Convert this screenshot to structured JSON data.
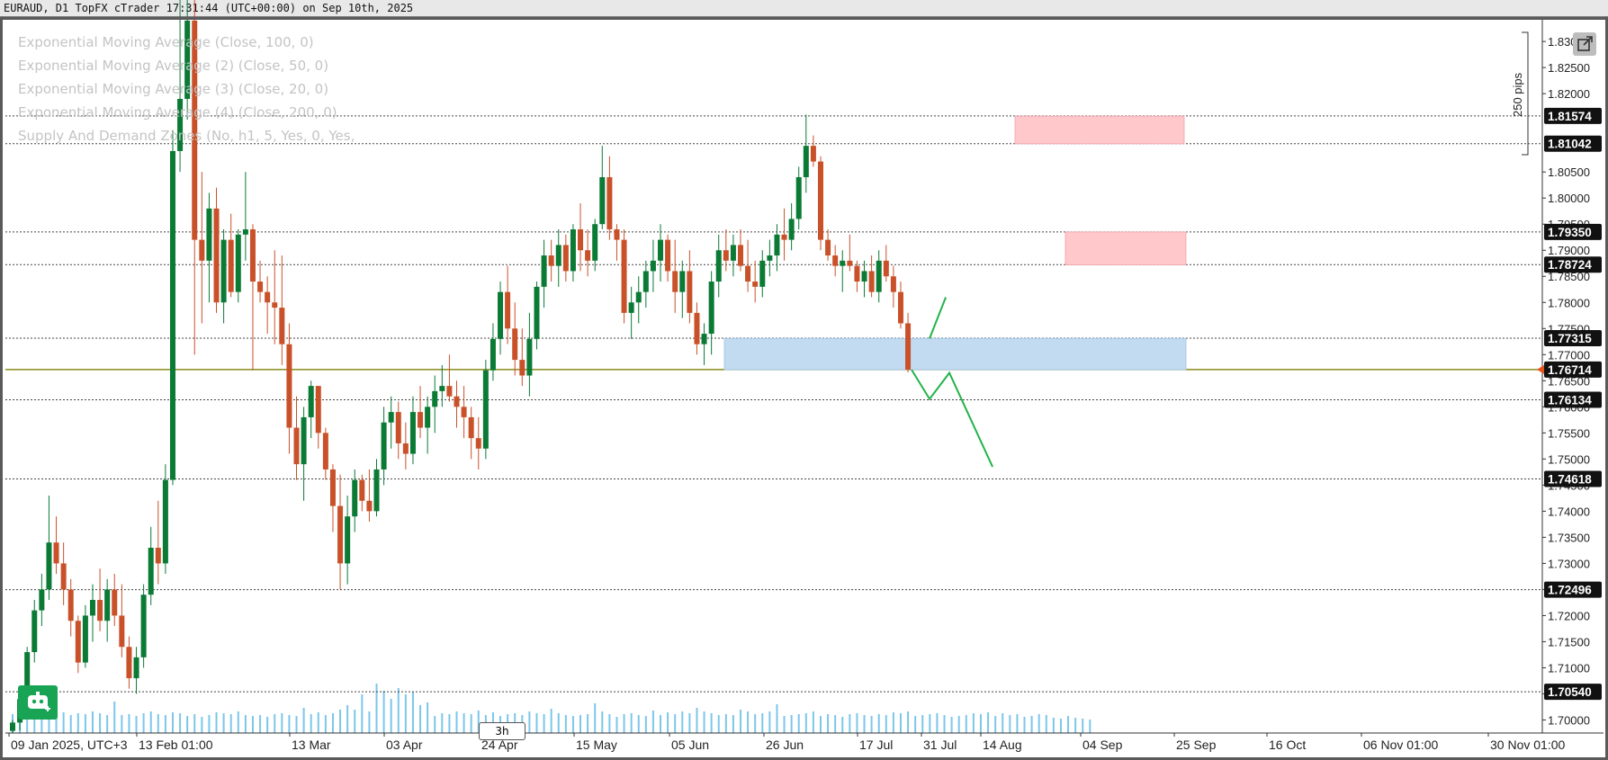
{
  "header": {
    "title": "EURAUD, D1 TopFX cTrader 17:31:44 (UTC+00:00) on Sep 10th, 2025"
  },
  "indicators": [
    "Exponential Moving Average (Close, 100, 0)",
    "Exponential Moving Average (2) (Close, 50, 0)",
    "Exponential Moving Average (3) (Close, 20, 0)",
    "Exponential Moving Average (4) (Close, 200, 0)",
    "Supply And Demand Zones (No, h1, 5, Yes, 0, Yes,"
  ],
  "timeframe_label": "3h",
  "ruler_label": "250 pips",
  "icons": [
    "bot-icon",
    "popout-icon"
  ],
  "colors": {
    "bull": "#0a7a35",
    "bear": "#c9512a",
    "volume": "#7cc6ea",
    "supply_zone": "#ffc9cc",
    "demand_zone": "#c2dbf0",
    "current_price_line": "#8a8a1a",
    "projection": "#22b34a"
  },
  "chart_data": {
    "type": "candlestick",
    "symbol": "EURAUD",
    "timeframe": "D1",
    "x_ticks": [
      "09 Jan 2025, UTC+3",
      "13 Feb 01:00",
      "13 Mar",
      "03 Apr",
      "24 Apr",
      "15 May",
      "05 Jun",
      "26 Jun",
      "17 Jul",
      "31 Jul",
      "14 Aug",
      "04 Sep",
      "25 Sep",
      "16 Oct",
      "06 Nov 01:00",
      "30 Nov 01:00"
    ],
    "y_ticks": [
      "1.8300",
      "1.8250",
      "1.8200",
      "1.8050",
      "1.8000",
      "1.7950",
      "1.7900",
      "1.7850",
      "1.7800",
      "1.7750",
      "1.7700",
      "1.7650",
      "1.7600",
      "1.7550",
      "1.7500",
      "1.7450",
      "1.7400",
      "1.7350",
      "1.7300",
      "1.7250",
      "1.7200",
      "1.7150",
      "1.7100",
      "1.7050",
      "1.7000"
    ],
    "ylim": [
      1.6975,
      1.8345
    ],
    "price_levels": [
      "1.81574",
      "1.81042",
      "1.79350",
      "1.78724",
      "1.77315",
      "1.76714",
      "1.76134",
      "1.74618",
      "1.72496",
      "1.70540"
    ],
    "current_price": "1.76714",
    "zones": [
      {
        "type": "supply",
        "from": 1.8104,
        "to": 1.8157
      },
      {
        "type": "supply",
        "from": 1.7872,
        "to": 1.7935
      },
      {
        "type": "demand",
        "from": 1.7671,
        "to": 1.7731
      }
    ],
    "projection_path": [
      1.7731,
      1.781
    ],
    "projection_path_down": [
      1.7671,
      1.7615,
      1.7665,
      1.7485
    ],
    "candles": [
      [
        1.6979,
        1.7,
        1.6975,
        1.6995
      ],
      [
        1.6995,
        1.705,
        1.698,
        1.704
      ],
      [
        1.704,
        1.714,
        1.702,
        1.713
      ],
      [
        1.713,
        1.723,
        1.711,
        1.721
      ],
      [
        1.721,
        1.728,
        1.718,
        1.725
      ],
      [
        1.725,
        1.743,
        1.723,
        1.734
      ],
      [
        1.734,
        1.739,
        1.728,
        1.73
      ],
      [
        1.73,
        1.734,
        1.722,
        1.725
      ],
      [
        1.725,
        1.727,
        1.716,
        1.719
      ],
      [
        1.719,
        1.72,
        1.709,
        1.711
      ],
      [
        1.711,
        1.722,
        1.71,
        1.72
      ],
      [
        1.72,
        1.726,
        1.715,
        1.723
      ],
      [
        1.723,
        1.729,
        1.717,
        1.719
      ],
      [
        1.719,
        1.727,
        1.715,
        1.725
      ],
      [
        1.725,
        1.728,
        1.718,
        1.72
      ],
      [
        1.72,
        1.726,
        1.712,
        1.714
      ],
      [
        1.714,
        1.716,
        1.706,
        1.708
      ],
      [
        1.708,
        1.714,
        1.705,
        1.712
      ],
      [
        1.712,
        1.726,
        1.71,
        1.724
      ],
      [
        1.724,
        1.737,
        1.722,
        1.733
      ],
      [
        1.733,
        1.742,
        1.726,
        1.73
      ],
      [
        1.73,
        1.749,
        1.728,
        1.746
      ],
      [
        1.746,
        1.813,
        1.745,
        1.809
      ],
      [
        1.809,
        1.84,
        1.805,
        1.819
      ],
      [
        1.819,
        1.84,
        1.815,
        1.834
      ],
      [
        1.834,
        1.84,
        1.77,
        1.792
      ],
      [
        1.792,
        1.805,
        1.776,
        1.788
      ],
      [
        1.788,
        1.801,
        1.78,
        1.798
      ],
      [
        1.798,
        1.802,
        1.778,
        1.78
      ],
      [
        1.78,
        1.794,
        1.776,
        1.792
      ],
      [
        1.792,
        1.797,
        1.781,
        1.782
      ],
      [
        1.782,
        1.794,
        1.78,
        1.793
      ],
      [
        1.793,
        1.805,
        1.788,
        1.794
      ],
      [
        1.794,
        1.795,
        1.767,
        1.784
      ],
      [
        1.784,
        1.788,
        1.78,
        1.782
      ],
      [
        1.782,
        1.785,
        1.774,
        1.78
      ],
      [
        1.78,
        1.79,
        1.772,
        1.779
      ],
      [
        1.779,
        1.789,
        1.768,
        1.772
      ],
      [
        1.772,
        1.776,
        1.751,
        1.756
      ],
      [
        1.756,
        1.762,
        1.746,
        1.749
      ],
      [
        1.749,
        1.76,
        1.742,
        1.758
      ],
      [
        1.758,
        1.765,
        1.754,
        1.764
      ],
      [
        1.764,
        1.764,
        1.752,
        1.755
      ],
      [
        1.755,
        1.756,
        1.746,
        1.748
      ],
      [
        1.748,
        1.749,
        1.736,
        1.741
      ],
      [
        1.741,
        1.747,
        1.725,
        1.73
      ],
      [
        1.73,
        1.743,
        1.726,
        1.739
      ],
      [
        1.739,
        1.748,
        1.736,
        1.746
      ],
      [
        1.746,
        1.747,
        1.74,
        1.742
      ],
      [
        1.742,
        1.748,
        1.738,
        1.74
      ],
      [
        1.74,
        1.75,
        1.739,
        1.748
      ],
      [
        1.748,
        1.76,
        1.745,
        1.757
      ],
      [
        1.757,
        1.762,
        1.752,
        1.759
      ],
      [
        1.759,
        1.761,
        1.75,
        1.753
      ],
      [
        1.753,
        1.757,
        1.748,
        1.751
      ],
      [
        1.751,
        1.762,
        1.749,
        1.759
      ],
      [
        1.759,
        1.764,
        1.754,
        1.756
      ],
      [
        1.756,
        1.762,
        1.751,
        1.76
      ],
      [
        1.76,
        1.766,
        1.755,
        1.763
      ],
      [
        1.763,
        1.768,
        1.76,
        1.764
      ],
      [
        1.764,
        1.77,
        1.761,
        1.762
      ],
      [
        1.762,
        1.765,
        1.756,
        1.76
      ],
      [
        1.76,
        1.764,
        1.754,
        1.758
      ],
      [
        1.758,
        1.76,
        1.75,
        1.754
      ],
      [
        1.754,
        1.758,
        1.748,
        1.752
      ],
      [
        1.752,
        1.769,
        1.75,
        1.767
      ],
      [
        1.767,
        1.776,
        1.765,
        1.773
      ],
      [
        1.773,
        1.784,
        1.77,
        1.782
      ],
      [
        1.782,
        1.787,
        1.772,
        1.775
      ],
      [
        1.775,
        1.78,
        1.766,
        1.769
      ],
      [
        1.769,
        1.775,
        1.764,
        1.766
      ],
      [
        1.766,
        1.778,
        1.762,
        1.773
      ],
      [
        1.773,
        1.784,
        1.771,
        1.783
      ],
      [
        1.783,
        1.792,
        1.779,
        1.789
      ],
      [
        1.789,
        1.792,
        1.784,
        1.787
      ],
      [
        1.787,
        1.794,
        1.783,
        1.791
      ],
      [
        1.791,
        1.793,
        1.784,
        1.786
      ],
      [
        1.786,
        1.795,
        1.784,
        1.794
      ],
      [
        1.794,
        1.799,
        1.786,
        1.79
      ],
      [
        1.79,
        1.794,
        1.785,
        1.788
      ],
      [
        1.788,
        1.796,
        1.786,
        1.795
      ],
      [
        1.795,
        1.81,
        1.794,
        1.804
      ],
      [
        1.804,
        1.808,
        1.792,
        1.794
      ],
      [
        1.794,
        1.795,
        1.788,
        1.792
      ],
      [
        1.792,
        1.794,
        1.776,
        1.778
      ],
      [
        1.778,
        1.783,
        1.773,
        1.78
      ],
      [
        1.78,
        1.785,
        1.776,
        1.782
      ],
      [
        1.782,
        1.788,
        1.779,
        1.786
      ],
      [
        1.786,
        1.792,
        1.782,
        1.788
      ],
      [
        1.788,
        1.795,
        1.784,
        1.792
      ],
      [
        1.792,
        1.793,
        1.784,
        1.786
      ],
      [
        1.786,
        1.792,
        1.778,
        1.782
      ],
      [
        1.782,
        1.788,
        1.777,
        1.786
      ],
      [
        1.786,
        1.79,
        1.776,
        1.778
      ],
      [
        1.778,
        1.78,
        1.77,
        1.772
      ],
      [
        1.772,
        1.776,
        1.768,
        1.774
      ],
      [
        1.774,
        1.786,
        1.77,
        1.784
      ],
      [
        1.784,
        1.793,
        1.781,
        1.79
      ],
      [
        1.79,
        1.794,
        1.786,
        1.788
      ],
      [
        1.788,
        1.793,
        1.785,
        1.791
      ],
      [
        1.791,
        1.794,
        1.786,
        1.787
      ],
      [
        1.787,
        1.792,
        1.782,
        1.784
      ],
      [
        1.784,
        1.788,
        1.78,
        1.783
      ],
      [
        1.783,
        1.79,
        1.781,
        1.788
      ],
      [
        1.788,
        1.792,
        1.785,
        1.789
      ],
      [
        1.789,
        1.795,
        1.786,
        1.793
      ],
      [
        1.793,
        1.798,
        1.788,
        1.792
      ],
      [
        1.792,
        1.799,
        1.79,
        1.796
      ],
      [
        1.796,
        1.806,
        1.794,
        1.804
      ],
      [
        1.804,
        1.816,
        1.801,
        1.81
      ],
      [
        1.81,
        1.812,
        1.806,
        1.807
      ],
      [
        1.807,
        1.808,
        1.79,
        1.792
      ],
      [
        1.792,
        1.794,
        1.788,
        1.789
      ],
      [
        1.789,
        1.791,
        1.785,
        1.787
      ],
      [
        1.787,
        1.79,
        1.782,
        1.788
      ],
      [
        1.788,
        1.793,
        1.786,
        1.787
      ],
      [
        1.787,
        1.788,
        1.782,
        1.784
      ],
      [
        1.784,
        1.788,
        1.781,
        1.786
      ],
      [
        1.786,
        1.789,
        1.781,
        1.782
      ],
      [
        1.782,
        1.79,
        1.78,
        1.788
      ],
      [
        1.788,
        1.791,
        1.784,
        1.785
      ],
      [
        1.785,
        1.787,
        1.779,
        1.782
      ],
      [
        1.782,
        1.784,
        1.775,
        1.776
      ],
      [
        1.776,
        1.778,
        1.7666,
        1.7671
      ]
    ],
    "volume": [
      21,
      21,
      19,
      22,
      24,
      21,
      18,
      23,
      20,
      22,
      21,
      24,
      22,
      20,
      35,
      20,
      21,
      19,
      22,
      24,
      21,
      20,
      23,
      22,
      19,
      21,
      18,
      20,
      23,
      22,
      21,
      24,
      20,
      19,
      20,
      18,
      21,
      22,
      20,
      19,
      28,
      21,
      23,
      20,
      22,
      26,
      31,
      26,
      43,
      24,
      55,
      47,
      38,
      50,
      43,
      46,
      31,
      34,
      19,
      22,
      21,
      24,
      22,
      21,
      25,
      20,
      23,
      19,
      21,
      22,
      20,
      24,
      22,
      21,
      27,
      22,
      20,
      19,
      20,
      21,
      33,
      24,
      21,
      18,
      21,
      22,
      20,
      19,
      25,
      20,
      23,
      21,
      24,
      22,
      28,
      24,
      22,
      20,
      21,
      20,
      26,
      24,
      21,
      22,
      24,
      32,
      19,
      20,
      21,
      22,
      24,
      19,
      21,
      20,
      18,
      21,
      22,
      20,
      19,
      21,
      20,
      23,
      22,
      24,
      19,
      20,
      21,
      22,
      20,
      18,
      19,
      20,
      22,
      21,
      23,
      19,
      22,
      20,
      21,
      18,
      19,
      21,
      20,
      17,
      16,
      19,
      17,
      16,
      15
    ]
  }
}
